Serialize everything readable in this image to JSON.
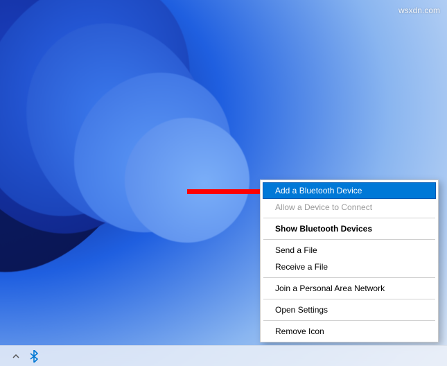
{
  "watermark": "wsxdn.com",
  "context_menu": {
    "items": [
      {
        "label": "Add a Bluetooth Device",
        "state": "highlighted"
      },
      {
        "label": "Allow a Device to Connect",
        "state": "disabled"
      },
      {
        "label": "Show Bluetooth Devices",
        "state": "bold"
      },
      {
        "label": "Send a File",
        "state": "normal"
      },
      {
        "label": "Receive a File",
        "state": "normal"
      },
      {
        "label": "Join a Personal Area Network",
        "state": "normal"
      },
      {
        "label": "Open Settings",
        "state": "normal"
      },
      {
        "label": "Remove Icon",
        "state": "normal"
      }
    ]
  },
  "tray": {
    "overflow": "˄",
    "bluetooth": "B"
  }
}
